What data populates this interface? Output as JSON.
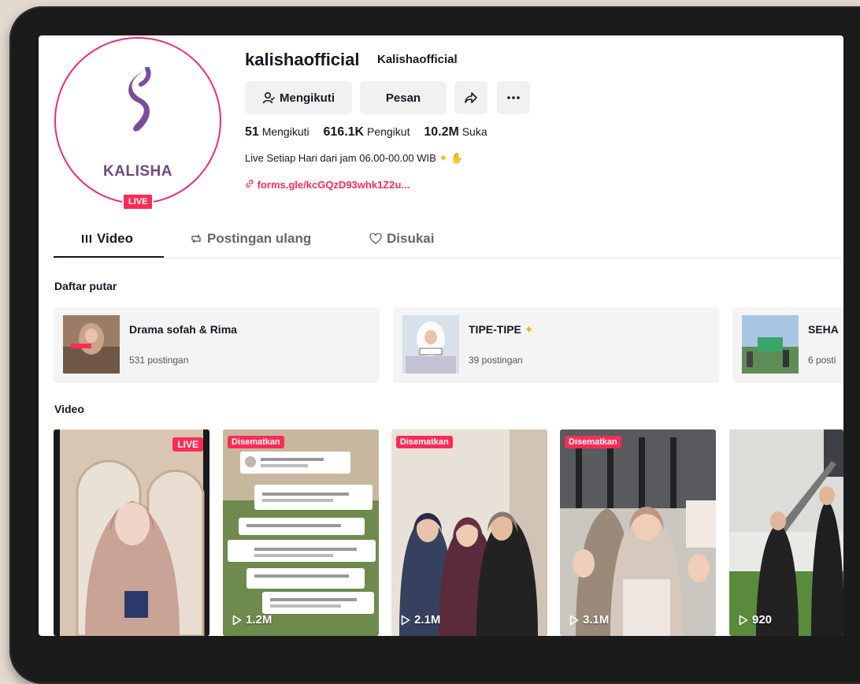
{
  "profile": {
    "username": "kalishaofficial",
    "nickname": "Kalishaofficial",
    "logo_text": "KALISHA",
    "live_badge": "LIVE",
    "buttons": {
      "follow": "Mengikuti",
      "message": "Pesan"
    },
    "stats": {
      "following_count": "51",
      "following_label": "Mengikuti",
      "followers_count": "616.1K",
      "followers_label": "Pengikut",
      "likes_count": "10.2M",
      "likes_label": "Suka"
    },
    "bio": "Live Setiap Hari dari jam 06.00-00.00 WIB",
    "link": "forms.gle/kcGQzD93whk1Z2u..."
  },
  "tabs": {
    "videos": "Video",
    "reposts": "Postingan ulang",
    "liked": "Disukai"
  },
  "playlists": {
    "title": "Daftar putar",
    "items": [
      {
        "title": "Drama sofah & Rima",
        "count": "531 postingan"
      },
      {
        "title": "TIPE-TIPE",
        "count": "39 postingan"
      },
      {
        "title": "SEHA",
        "count": "6 posti"
      }
    ]
  },
  "videos": {
    "title": "Video",
    "pinned_label": "Disematkan",
    "live_label": "LIVE",
    "items": [
      {
        "views": ""
      },
      {
        "views": "1.2M"
      },
      {
        "views": "2.1M"
      },
      {
        "views": "3.1M"
      },
      {
        "views": "920"
      }
    ]
  },
  "colors": {
    "accent": "#fe2c55",
    "logo": "#6b4a86",
    "ring": "#ee2a7b"
  }
}
